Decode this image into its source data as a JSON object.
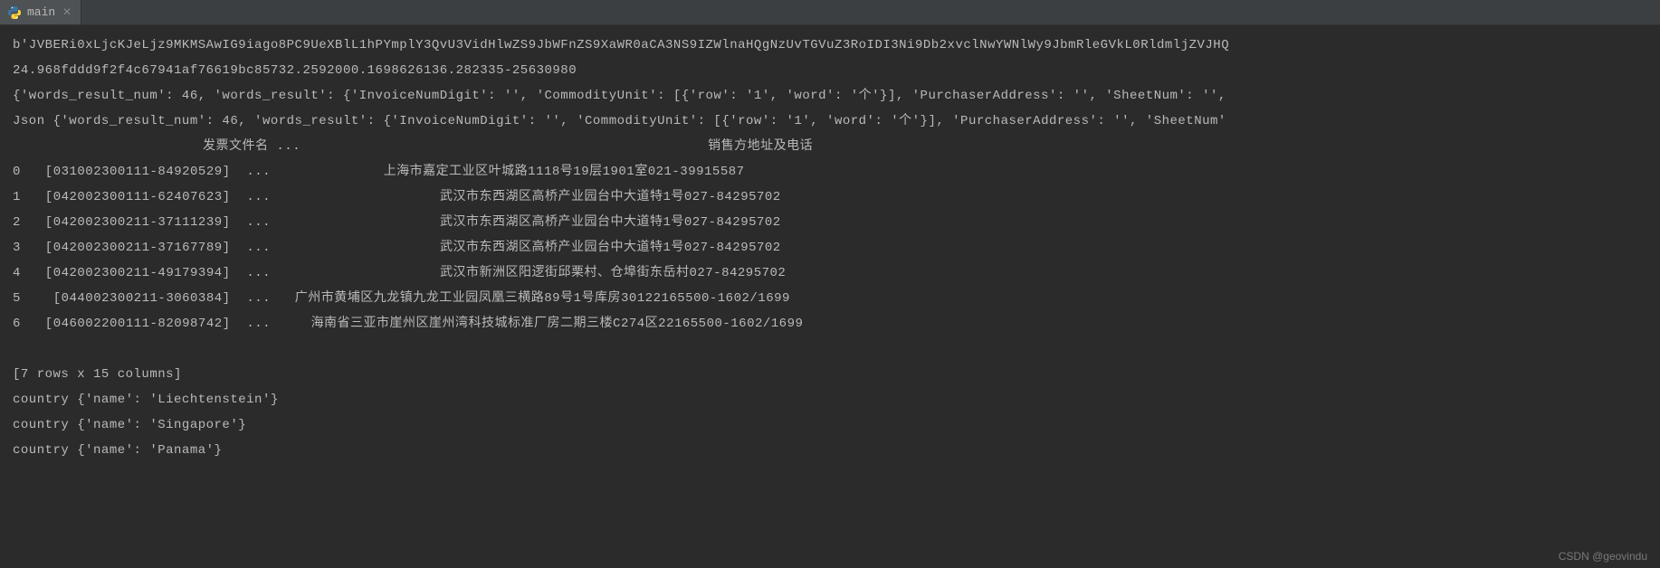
{
  "tab": {
    "label": "main",
    "icon": "python-icon"
  },
  "output": {
    "line1": "b'JVBERi0xLjcKJeLjz9MKMSAwIG9iago8PC9UeXBlL1hPYmplY3QvU3VidHlwZS9JbWFnZS9XaWR0aCA3NS9IZWlnaHQgNzUvTGVuZ3RoIDI3Ni9Db2xvclNwYWNlWy9JbmRleGVkL0RldmljZVJHQ",
    "line2": "24.968fddd9f2f4c67941af76619bc85732.2592000.1698626136.282335-25630980",
    "line3": "{'words_result_num': 46, 'words_result': {'InvoiceNumDigit': '', 'CommodityUnit': [{'row': '1', 'word': '个'}], 'PurchaserAddress': '', 'SheetNum': '',",
    "line4": "Json {'words_result_num': 46, 'words_result': {'InvoiceNumDigit': '', 'CommodityUnit': [{'row': '1', 'word': '个'}], 'PurchaserAddress': '', 'SheetNum'",
    "headers": {
      "col1": "发票文件名   ...",
      "col2": "销售方地址及电话"
    },
    "rows": [
      {
        "idx": "0",
        "file": "  [031002300111-84920529]",
        "ellipsis": "  ...              ",
        "addr": "上海市嘉定工业区叶城路1118号19层1901室021-39915587"
      },
      {
        "idx": "1",
        "file": "  [042002300111-62407623]",
        "ellipsis": "  ...                     ",
        "addr": "武汉市东西湖区高桥产业园台中大道特1号027-84295702"
      },
      {
        "idx": "2",
        "file": "  [042002300211-37111239]",
        "ellipsis": "  ...                     ",
        "addr": "武汉市东西湖区高桥产业园台中大道特1号027-84295702"
      },
      {
        "idx": "3",
        "file": "  [042002300211-37167789]",
        "ellipsis": "  ...                     ",
        "addr": "武汉市东西湖区高桥产业园台中大道特1号027-84295702"
      },
      {
        "idx": "4",
        "file": "  [042002300211-49179394]",
        "ellipsis": "  ...                     ",
        "addr": "武汉市新洲区阳逻街邱栗村、仓埠街东岳村027-84295702"
      },
      {
        "idx": "5",
        "file": "   [044002300211-3060384]",
        "ellipsis": "  ...   ",
        "addr": "广州市黄埔区九龙镇九龙工业园凤凰三横路89号1号库房30122165500-1602/1699"
      },
      {
        "idx": "6",
        "file": "  [046002200111-82098742]",
        "ellipsis": "  ...     ",
        "addr": "海南省三亚市崖州区崖州湾科技城标准厂房二期三楼C274区22165500-1602/1699"
      }
    ],
    "summary": "[7 rows x 15 columns]",
    "countries": [
      "country {'name': 'Liechtenstein'}",
      "country {'name': 'Singapore'}",
      "country {'name': 'Panama'}"
    ]
  },
  "watermark": "CSDN @geovindu"
}
